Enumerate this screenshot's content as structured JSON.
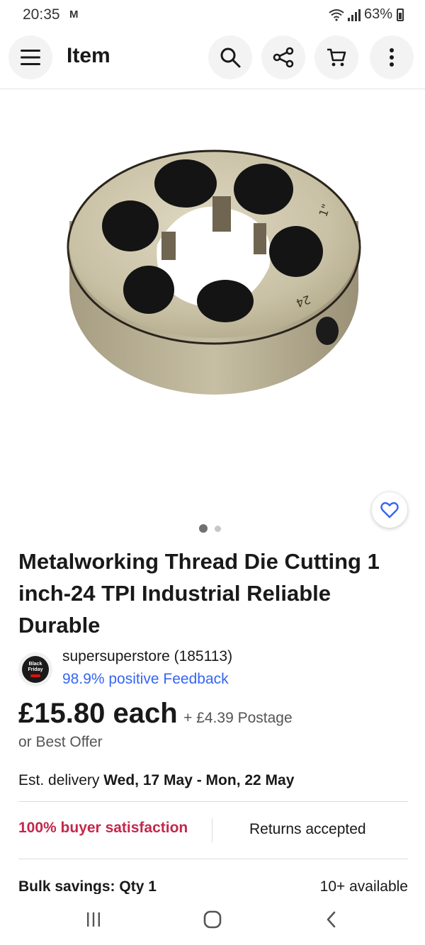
{
  "status_bar": {
    "time": "20:35",
    "app_icon": "M",
    "battery": "63%"
  },
  "header": {
    "title": "Item",
    "icons": [
      "menu-icon",
      "search-icon",
      "share-icon",
      "cart-icon",
      "more-icon"
    ]
  },
  "gallery": {
    "image_marking_top": "1\"",
    "image_marking_bottom": "24",
    "active_index": 0,
    "count": 2
  },
  "listing": {
    "title": "Metalworking Thread Die Cutting 1 inch-24 TPI Industrial Reliable Durable",
    "seller_name": "supersuperstore (185113)",
    "seller_feedback": "98.9% positive Feedback",
    "seller_badge_text": "Black Friday",
    "price": "£15.80 each",
    "postage": "+ £4.39 Postage",
    "best_offer": "or Best Offer",
    "delivery_label": "Est. delivery",
    "delivery_dates": "Wed, 17 May - Mon, 22 May",
    "satisfaction": "100% buyer satisfaction",
    "returns": "Returns accepted",
    "bulk_savings": "Bulk savings: Qty 1",
    "available": "10+ available"
  },
  "colors": {
    "link": "#3665f3",
    "satisfaction": "#c4274b",
    "text": "#191919"
  }
}
